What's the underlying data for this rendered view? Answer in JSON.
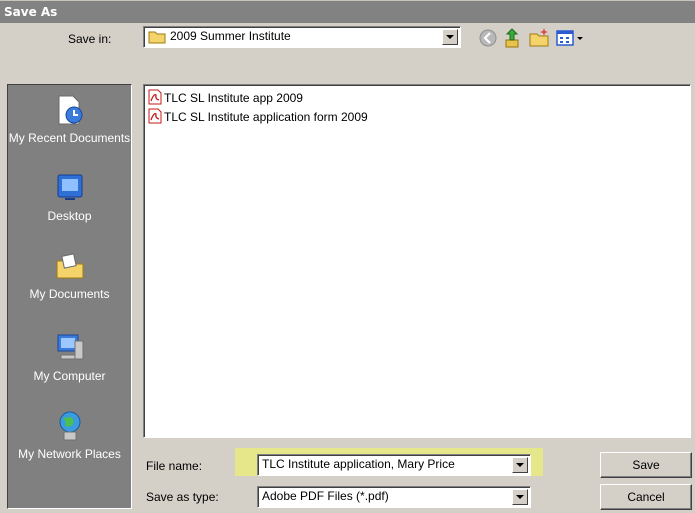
{
  "window": {
    "title": "Save As"
  },
  "save_in": {
    "label": "Save in:",
    "value": "2009 Summer Institute"
  },
  "toolbar": {
    "back_icon": "back-arrow-icon",
    "up_icon": "up-folder-icon",
    "new_folder_icon": "new-folder-icon",
    "views_icon": "views-menu-icon"
  },
  "places": [
    {
      "label": "My Recent Documents",
      "icon": "recent-documents-icon"
    },
    {
      "label": "Desktop",
      "icon": "desktop-icon"
    },
    {
      "label": "My Documents",
      "icon": "my-documents-icon"
    },
    {
      "label": "My Computer",
      "icon": "my-computer-icon"
    },
    {
      "label": "My Network Places",
      "icon": "network-places-icon"
    }
  ],
  "files": [
    {
      "name": "TLC SL Institute app 2009",
      "icon": "pdf-file-icon"
    },
    {
      "name": "TLC SL Institute application form 2009",
      "icon": "pdf-file-icon"
    }
  ],
  "file_name": {
    "label": "File name:",
    "value": "TLC Institute application, Mary Price"
  },
  "save_type": {
    "label": "Save as type:",
    "value": "Adobe PDF Files (*.pdf)"
  },
  "buttons": {
    "save": "Save",
    "cancel": "Cancel"
  },
  "colors": {
    "title_bg": "#828282",
    "dialog_bg": "#d4d0c8",
    "places_bg": "#808080",
    "highlight": "#e6e68a"
  }
}
